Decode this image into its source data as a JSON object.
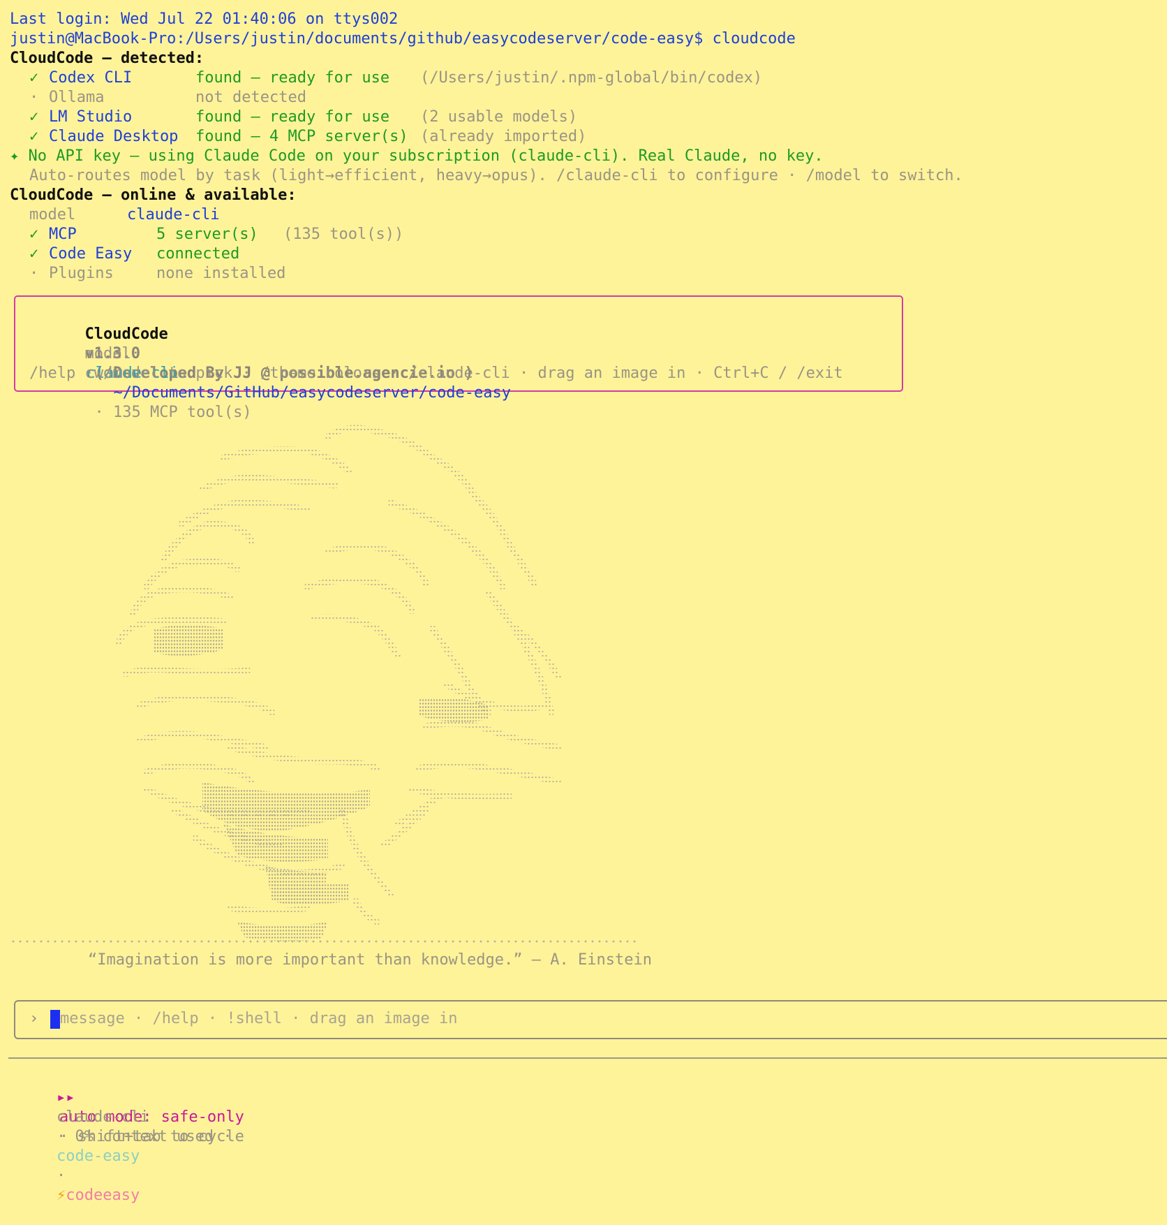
{
  "terminal": {
    "last_login": "Last login: Wed Jul 22 01:40:06 on ttys002",
    "prompt_path": "justin@MacBook-Pro:/Users/justin/documents/github/easycodeserver/code-easy$ cloudcode"
  },
  "detected": {
    "heading": "CloudCode — detected:",
    "items": [
      {
        "mark": "✓",
        "name": "Codex CLI",
        "status": "found — ready for use",
        "detail": "(/Users/justin/.npm-global/bin/codex)",
        "found": true
      },
      {
        "mark": "·",
        "name": "Ollama",
        "status": "not detected",
        "detail": "",
        "found": false
      },
      {
        "mark": "✓",
        "name": "LM Studio",
        "status": "found — ready for use",
        "detail": "(2 usable models)",
        "found": true
      },
      {
        "mark": "✓",
        "name": "Claude Desktop",
        "status": "found — 4 MCP server(s)",
        "detail": "(already imported)",
        "found": true
      }
    ]
  },
  "api_notice": {
    "line1": "✦ No API key — using Claude Code on your subscription (claude-cli). Real Claude, no key.",
    "line2": "Auto-routes model by task (light→efficient, heavy→opus). /claude-cli to configure · /model to switch."
  },
  "online": {
    "heading": "CloudCode — online & available:",
    "model_label": "model",
    "model_value": "claude-cli",
    "items": [
      {
        "mark": "✓",
        "name": "MCP",
        "status": "5 server(s)",
        "detail": "(135 tool(s))"
      },
      {
        "mark": "✓",
        "name": "Code Easy",
        "status": "connected",
        "detail": ""
      },
      {
        "mark": "·",
        "name": "Plugins",
        "status": "none installed",
        "detail": ""
      }
    ]
  },
  "info_box": {
    "app_name": "CloudCode",
    "version": "v1.3.0",
    "credit": "( Developed By JJ @ possible.agencie.io )",
    "model_label": "model",
    "model_value": "claude-cli",
    "cwd_label": "cwd",
    "cwd_value": "~/Documents/GitHub/easycodeserver/code-easy",
    "cwd_extra": "· 135 MCP tool(s)",
    "hints": "/help · /model to pick · /theme colors · /claude-cli · drag an image in · Ctrl+C / /exit"
  },
  "quote": "“Imagination is more important than knowledge.” — A. Einstein",
  "input": {
    "prompt_glyph": "›",
    "placeholder": "message · /help · !shell · drag an image in"
  },
  "status": {
    "mode_glyph": "▸▸",
    "mode_label": "auto mode: safe-only",
    "mode_hint": "· shift+tab to cycle",
    "model": "claude-cli",
    "context": "· 0% context used ·",
    "project": "code-easy",
    "sep": "·",
    "bolt": "⚡",
    "branch": "codeeasy"
  },
  "colors": {
    "background": "#fff399",
    "blue": "#1d3fd8",
    "green": "#1e9a23",
    "magenta": "#c8189c",
    "box_border": "#d43aa8"
  }
}
